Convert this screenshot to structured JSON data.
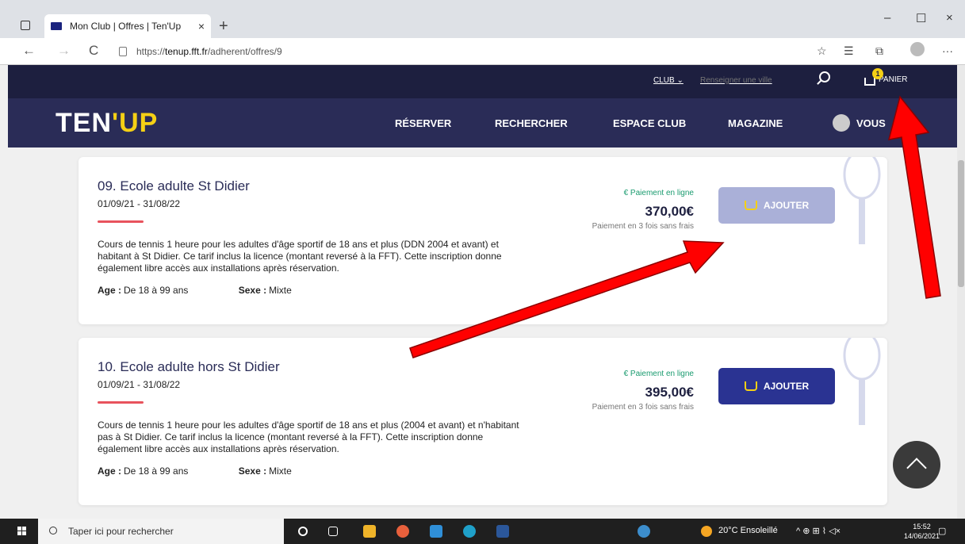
{
  "browser": {
    "tab_title": "Mon Club | Offres | Ten'Up",
    "tab_close": "×",
    "new_tab": "+",
    "url_prefix": "https://",
    "url_host": "tenup.fft.fr",
    "url_path": "/adherent/offres/9",
    "back": "←",
    "forward": "→",
    "refresh": "C",
    "more": "···",
    "minimize": "–",
    "maximize": "☐",
    "close": "×"
  },
  "header": {
    "club_select": "CLUB ⌄",
    "city_placeholder": "Renseigner une ville",
    "cart_count": "1",
    "cart_label": "PANIER"
  },
  "nav": {
    "logo_part1": "TEN",
    "logo_part2": "'UP",
    "items": [
      "RÉSERVER",
      "RECHERCHER",
      "ESPACE CLUB",
      "MAGAZINE"
    ],
    "user_label": "VOUS"
  },
  "offers": [
    {
      "title": "09. Ecole adulte St Didier",
      "dates": "01/09/21 - 31/08/22",
      "description": "Cours de tennis 1 heure pour les adultes d'âge sportif de 18 ans et plus (DDN 2004 et avant) et habitant à St Didier. Ce tarif inclus la licence (montant reversé à la FFT). Cette inscription donne également libre accès aux installations après réservation.",
      "age_label": "Age :",
      "age_value": "De 18 à 99 ans",
      "sexe_label": "Sexe :",
      "sexe_value": "Mixte",
      "payment_label": "€ Paiement en ligne",
      "price": "370,00€",
      "payment_note": "Paiement en 3 fois sans frais",
      "button": "AJOUTER",
      "button_state": "disabled"
    },
    {
      "title": "10. Ecole adulte hors St Didier",
      "dates": "01/09/21 - 31/08/22",
      "description": "Cours de tennis 1 heure pour les adultes d'âge sportif de 18 ans et plus (2004 et avant) et n'habitant pas à St Didier. Ce tarif inclus la licence (montant reversé à la FFT). Cette inscription donne également libre accès aux installations après réservation.",
      "age_label": "Age :",
      "age_value": "De 18 à 99 ans",
      "sexe_label": "Sexe :",
      "sexe_value": "Mixte",
      "payment_label": "€ Paiement en ligne",
      "price": "395,00€",
      "payment_note": "Paiement en 3 fois sans frais",
      "button": "AJOUTER",
      "button_state": "active"
    }
  ],
  "taskbar": {
    "search_placeholder": "Taper ici pour rechercher",
    "weather": "20°C Ensoleillé",
    "time": "15:52",
    "date": "14/06/2021"
  },
  "colors": {
    "header_dark": "#1d1f3f",
    "nav_bg": "#2a2c57",
    "accent_yellow": "#f5d015",
    "button_active": "#2a3392",
    "button_disabled": "#aab0d8",
    "accent_red": "#e8535d",
    "arrow_red": "#ff0000"
  }
}
